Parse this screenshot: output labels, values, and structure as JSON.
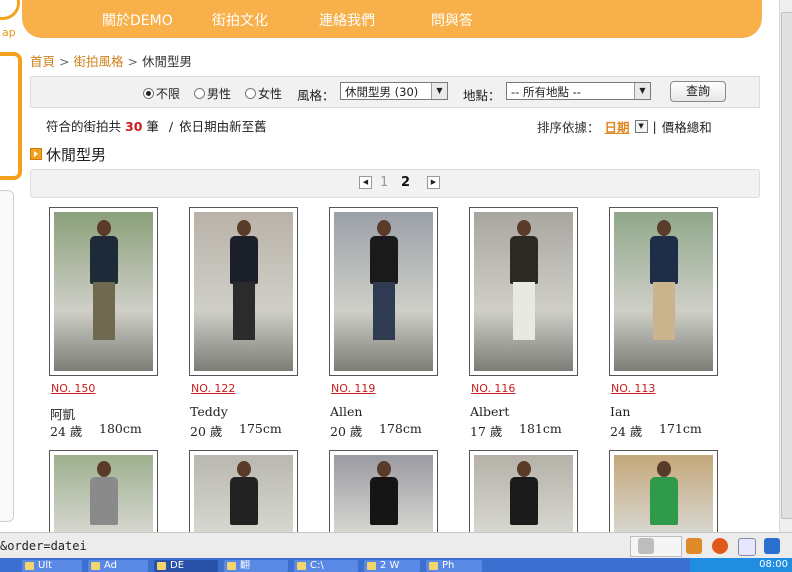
{
  "logo": {
    "text": "ap"
  },
  "nav": {
    "items": [
      "關於DEMO",
      "街拍文化",
      "連絡我們",
      "問與答"
    ]
  },
  "breadcrumb": {
    "home": "首頁",
    "style": "街拍風格",
    "current": "休閒型男",
    "sep": ">"
  },
  "filter": {
    "radios": [
      {
        "label": "不限",
        "checked": true
      },
      {
        "label": "男性",
        "checked": false
      },
      {
        "label": "女性",
        "checked": false
      }
    ],
    "style_label": "風格：",
    "style_value": "休閒型男 (30)",
    "location_label": "地點：",
    "location_value": "-- 所有地點 --",
    "query_button": "查詢"
  },
  "results": {
    "prefix": "符合的街拍共",
    "count": "30",
    "suffix": "筆",
    "slash": "/",
    "order": "依日期由新至舊",
    "sort_label": "排序依據：",
    "sort_date": "日期",
    "sort_divider": "|",
    "sort_price": "價格總和"
  },
  "section": {
    "title": "休閒型男"
  },
  "pager": {
    "pages": [
      "1",
      "2"
    ],
    "current": "2"
  },
  "people": [
    {
      "no": "NO. 150",
      "name": "阿凱",
      "age": "24 歲",
      "height": "180cm",
      "bg": "#8aa07a",
      "top": "#1e2a38",
      "legs": "#6f6a4f"
    },
    {
      "no": "NO. 122",
      "name": "Teddy",
      "age": "20 歲",
      "height": "175cm",
      "bg": "#b9b2a8",
      "top": "#1b1f2a",
      "legs": "#2b2b2b"
    },
    {
      "no": "NO. 119",
      "name": "Allen",
      "age": "20 歲",
      "height": "178cm",
      "bg": "#9aa0a8",
      "top": "#1a1a1a",
      "legs": "#2f3b52"
    },
    {
      "no": "NO. 116",
      "name": "Albert",
      "age": "17 歲",
      "height": "181cm",
      "bg": "#a9a6a0",
      "top": "#2a2a22",
      "legs": "#e9e9e4"
    },
    {
      "no": "NO. 113",
      "name": "Ian",
      "age": "24 歲",
      "height": "171cm",
      "bg": "#8fa78a",
      "top": "#1d2d48",
      "legs": "#c9b48e"
    }
  ],
  "row2": [
    {
      "bg": "#9db08e",
      "top": "#8a8a8a"
    },
    {
      "bg": "#b8b8b0",
      "top": "#222222"
    },
    {
      "bg": "#9a9aa2",
      "top": "#151515"
    },
    {
      "bg": "#b5b1a8",
      "top": "#1a1a1a"
    },
    {
      "bg": "#c4a77a",
      "top": "#2f9a4a"
    }
  ],
  "status": {
    "url": "&order=datei"
  },
  "taskbar": {
    "tasks": [
      "Ult",
      "Ad",
      "DE",
      "翻",
      "C:\\",
      "2 W",
      "Ph"
    ],
    "clock": "08:00"
  }
}
